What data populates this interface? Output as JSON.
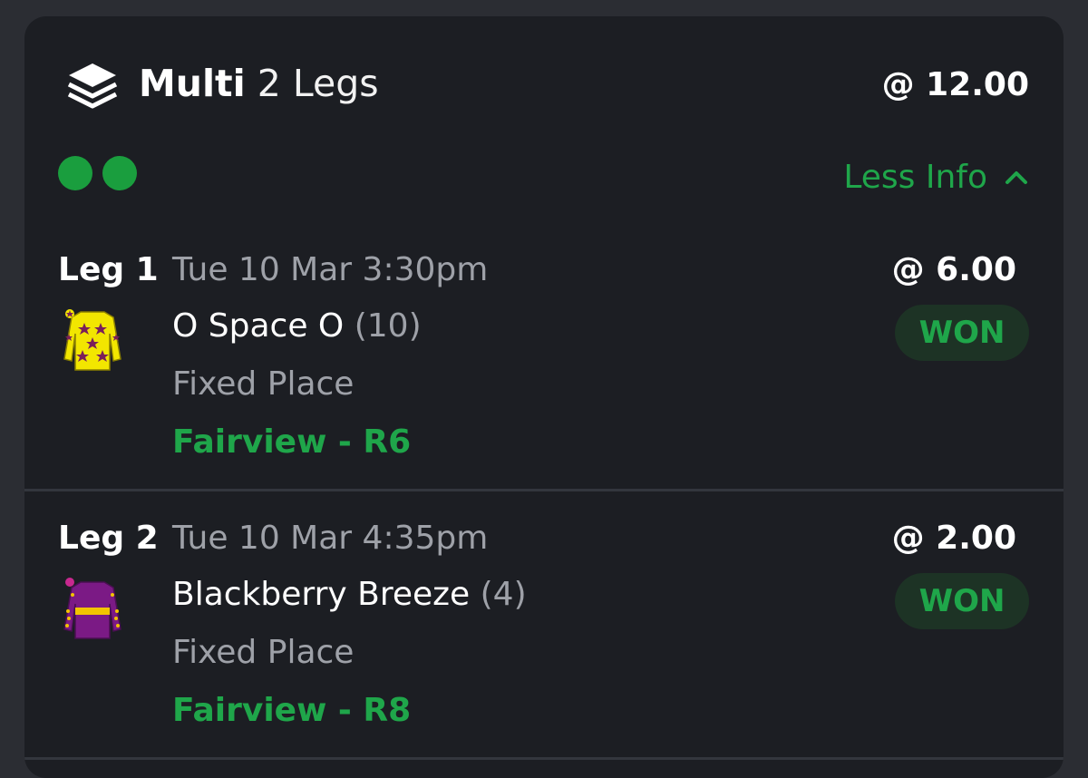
{
  "header": {
    "title_strong": "Multi",
    "title_light": "2 Legs",
    "total_odds": "@ 12.00",
    "icon": "layers-stack-icon"
  },
  "status_dots": [
    "won",
    "won"
  ],
  "colors": {
    "accent_green": "#1fa64a",
    "dot_green": "#1a9e3e",
    "badge_bg": "#1d3325",
    "card_bg": "#1c1e23"
  },
  "toggle": {
    "label": "Less Info",
    "icon": "chevron-up-icon"
  },
  "legs": [
    {
      "label": "Leg 1",
      "time": "Tue 10 Mar 3:30pm",
      "odds": "@ 6.00",
      "runner": "O Space O",
      "number": "(10)",
      "bet_type": "Fixed Place",
      "race": "Fairview - R6",
      "status": "WON",
      "silk": "yellow-purple-stars-silk-icon"
    },
    {
      "label": "Leg 2",
      "time": "Tue 10 Mar 4:35pm",
      "odds": "@ 2.00",
      "runner": "Blackberry Breeze",
      "number": "(4)",
      "bet_type": "Fixed Place",
      "race": "Fairview - R8",
      "status": "WON",
      "silk": "purple-yellow-band-silk-icon"
    }
  ]
}
